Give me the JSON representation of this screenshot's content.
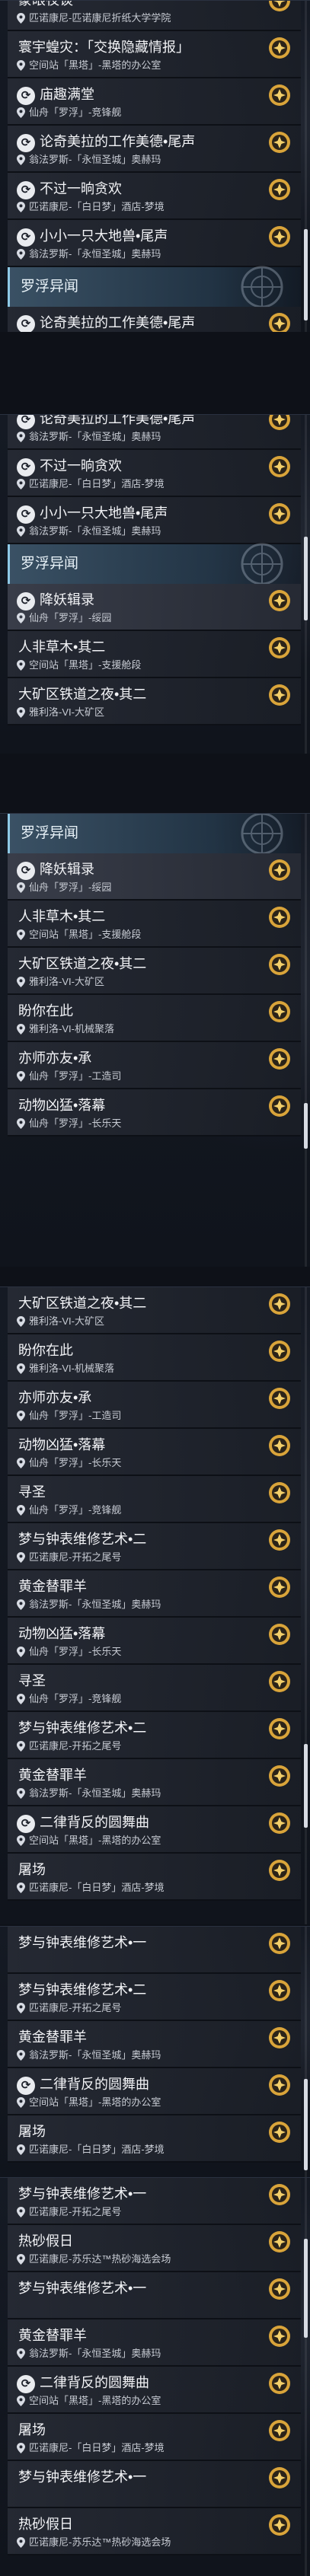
{
  "strings": {
    "title_blinding_night": "蒙眼夜谈",
    "title_info_exchange": "寰宇蝗灾：「交换隐藏情报」",
    "title_full_house": "庙趣满堂",
    "title_meldt_tail": "论奇美拉的工作美德•尾声",
    "title_greedy_mouth": "不过一晌贪欢",
    "title_little_beast_tail": "小小一只大地兽•尾声",
    "title_demon_record": "降妖辑录",
    "title_two": "人非草木•其二",
    "title_mining_two": "大矿区铁道之夜•其二",
    "title_look_forward": "盼你在此",
    "title_teacher_inherit": "亦师亦友•承",
    "title_animal_fall": "动物凶猛•落幕",
    "title_seek": "寻圣",
    "title_clock_two": "梦与钟表维修艺术•二",
    "title_goat": "黄金替罪羊",
    "title_dance": "二律背反的圆舞曲",
    "title_slaughter": "屠场",
    "title_clock_one": "梦与钟表维修艺术•一",
    "title_holiday": "热砂假日",
    "sub_penacony_folding": "匹诺康尼-匹诺康尼折纸大学学院",
    "sub_herta_office": "空间站「黑塔」-黑塔的办公室",
    "sub_xianzhou_jingci": "仙舟「罗浮」-竞锋舰",
    "sub_amphoreus_okhema": "翁法罗斯-「永恒圣城」奥赫玛",
    "sub_penacony_dreamscape": "匹诺康尼-「白日梦」酒店-梦境",
    "sub_xianzhou_suijing": "仙舟「罗浮」-绥园",
    "sub_herta_support": "空间站「黑塔」-支援舱段",
    "sub_jarilo_mining": "雅利洛-VI-大矿区",
    "sub_jarilo_robot": "雅利洛-VI-机械聚落",
    "sub_xianzhou_artisan": "仙舟「罗浮」-工造司",
    "sub_xianzhou_changle": "仙舟「罗浮」-长乐天",
    "sub_penacony_clock": "匹诺康尼-开拓之尾号",
    "sub_penacony_sand": "匹诺康尼-苏乐达™热砂海选会场",
    "group_xianzhou": "罗浮异闻"
  },
  "icons": {
    "location": "map-pin-icon",
    "mission_mark": "mission-swirl-icon",
    "reward": "stellar-jade-reward-icon",
    "emblem": "xianzhou-emblem-icon"
  },
  "colors": {
    "background": "#0e1118",
    "row": "#262a34",
    "row_highlight": "#3a3e4a",
    "group_header": "#3c5468",
    "group_accent": "#8ec9e6",
    "badge_outer": "#d9a43a",
    "badge_inner": "#f3cf6a",
    "scroll_thumb": "#d7dbe3"
  }
}
